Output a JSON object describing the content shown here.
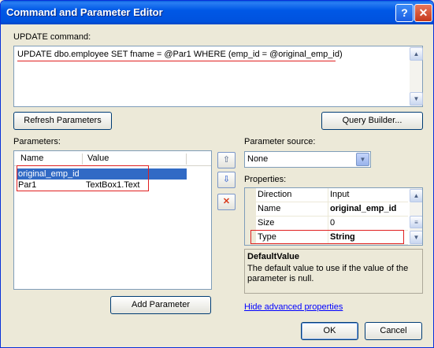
{
  "window": {
    "title": "Command and Parameter Editor",
    "help_glyph": "?",
    "close_glyph": "✕"
  },
  "command": {
    "label": "UPDATE command:",
    "text": "UPDATE dbo.employee SET fname = @Par1 WHERE (emp_id = @original_emp_id)"
  },
  "buttons": {
    "refresh": "Refresh Parameters",
    "query_builder": "Query Builder...",
    "add_parameter": "Add Parameter",
    "ok": "OK",
    "cancel": "Cancel"
  },
  "parameters": {
    "label": "Parameters:",
    "columns": [
      "Name",
      "Value"
    ],
    "rows": [
      {
        "name": "original_emp_id",
        "value": "",
        "selected": true
      },
      {
        "name": "Par1",
        "value": "TextBox1.Text",
        "selected": false
      }
    ]
  },
  "side_buttons": {
    "up_glyph": "⇧",
    "down_glyph": "⇩",
    "delete_glyph": "✕"
  },
  "parameter_source": {
    "label": "Parameter source:",
    "value": "None"
  },
  "properties": {
    "label": "Properties:",
    "rows": [
      {
        "name": "Direction",
        "value": "Input"
      },
      {
        "name": "Name",
        "value": "original_emp_id"
      },
      {
        "name": "Size",
        "value": "0"
      },
      {
        "name": "Type",
        "value": "String"
      }
    ]
  },
  "description": {
    "title": "DefaultValue",
    "text": "The default value to use if the value of the parameter is null."
  },
  "advanced_link": "Hide advanced properties",
  "colors": {
    "title_bar": "#0058e6",
    "selection": "#316ac5",
    "highlight_box": "#e02020",
    "link": "#0000ff"
  }
}
